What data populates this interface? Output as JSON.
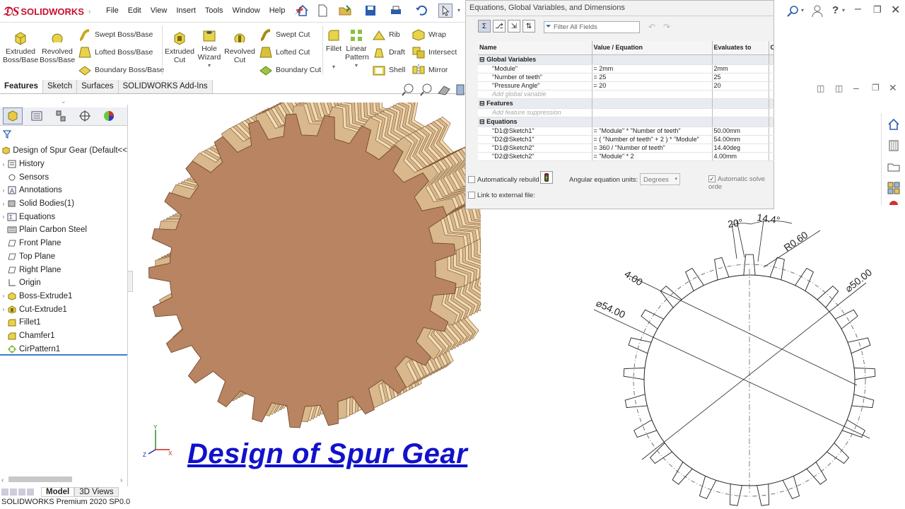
{
  "app": {
    "brand": "SOLIDWORKS"
  },
  "menu": [
    "File",
    "Edit",
    "View",
    "Insert",
    "Tools",
    "Window",
    "Help"
  ],
  "ribbon": {
    "extruded_boss": [
      "Extruded",
      "Boss/Base"
    ],
    "revolved_boss": [
      "Revolved",
      "Boss/Base"
    ],
    "swept_boss": "Swept Boss/Base",
    "lofted_boss": "Lofted Boss/Base",
    "boundary_boss": "Boundary Boss/Base",
    "extruded_cut": [
      "Extruded",
      "Cut"
    ],
    "hole_wizard": [
      "Hole",
      "Wizard"
    ],
    "revolved_cut": [
      "Revolved",
      "Cut"
    ],
    "swept_cut": "Swept Cut",
    "lofted_cut": "Lofted Cut",
    "boundary_cut": "Boundary Cut",
    "fillet": "Fillet",
    "linear_pattern": [
      "Linear",
      "Pattern"
    ],
    "rib": "Rib",
    "draft": "Draft",
    "shell": "Shell",
    "wrap": "Wrap",
    "intersect": "Intersect",
    "mirror": "Mirror"
  },
  "tabs": [
    "Features",
    "Sketch",
    "Surfaces",
    "SOLIDWORKS Add-Ins"
  ],
  "tree": {
    "root": "Design of Spur Gear  (Default<<",
    "items": [
      "History",
      "Sensors",
      "Annotations",
      "Solid Bodies(1)",
      "Equations",
      "Plain Carbon Steel",
      "Front Plane",
      "Top Plane",
      "Right Plane",
      "Origin",
      "Boss-Extrude1",
      "Cut-Extrude1",
      "Fillet1",
      "Chamfer1",
      "CirPattern1"
    ]
  },
  "bottom_tabs": [
    "Model",
    "3D Views"
  ],
  "status": "SOLIDWORKS Premium 2020 SP0.0",
  "heading": "Design of Spur Gear",
  "equations": {
    "title": "Equations, Global Variables, and Dimensions",
    "filter_placeholder": "Filter All Fields",
    "columns": [
      "Name",
      "Value / Equation",
      "Evaluates to",
      "Co"
    ],
    "sections": {
      "global": "Global Variables",
      "features": "Features",
      "equations": "Equations"
    },
    "globals": [
      {
        "name": "\"Module\"",
        "value": "= 2mm",
        "eval": "2mm"
      },
      {
        "name": "\"Number of teeth\"",
        "value": "= 25",
        "eval": "25"
      },
      {
        "name": "\"Pressure Angle\"",
        "value": "= 20",
        "eval": "20"
      }
    ],
    "add_global": "Add global variable",
    "add_feature": "Add feature suppression",
    "rows": [
      {
        "name": "\"D1@Sketch1\"",
        "value": "= \"Module\" * \"Number of teeth\"",
        "eval": "50.00mm"
      },
      {
        "name": "\"D2@Sketch1\"",
        "value": "= ( \"Number of teeth\" + 2 ) * \"Module\"",
        "eval": "54.00mm"
      },
      {
        "name": "\"D1@Sketch2\"",
        "value": "= 360 / \"Number of teeth\"",
        "eval": "14.40deg"
      },
      {
        "name": "\"D2@Sketch2\"",
        "value": "= \"Module\" * 2",
        "eval": "4.00mm"
      }
    ],
    "auto_rebuild": "Automatically rebuild",
    "angular_units_label": "Angular equation units:",
    "angular_units": "Degrees",
    "auto_solve": "Automatic solve orde",
    "link_external": "Link to external file:"
  },
  "drawing": {
    "dim_20": "20°",
    "dim_14_4": "14.4°",
    "dim_r060": "R0.60",
    "dim_4": "4.00",
    "dim_d50": "⌀50.00",
    "dim_d54": "⌀54.00",
    "teeth": 25
  },
  "colors": {
    "accent": "#1111cc",
    "brand": "#c8102e",
    "gear": "#b98462"
  }
}
